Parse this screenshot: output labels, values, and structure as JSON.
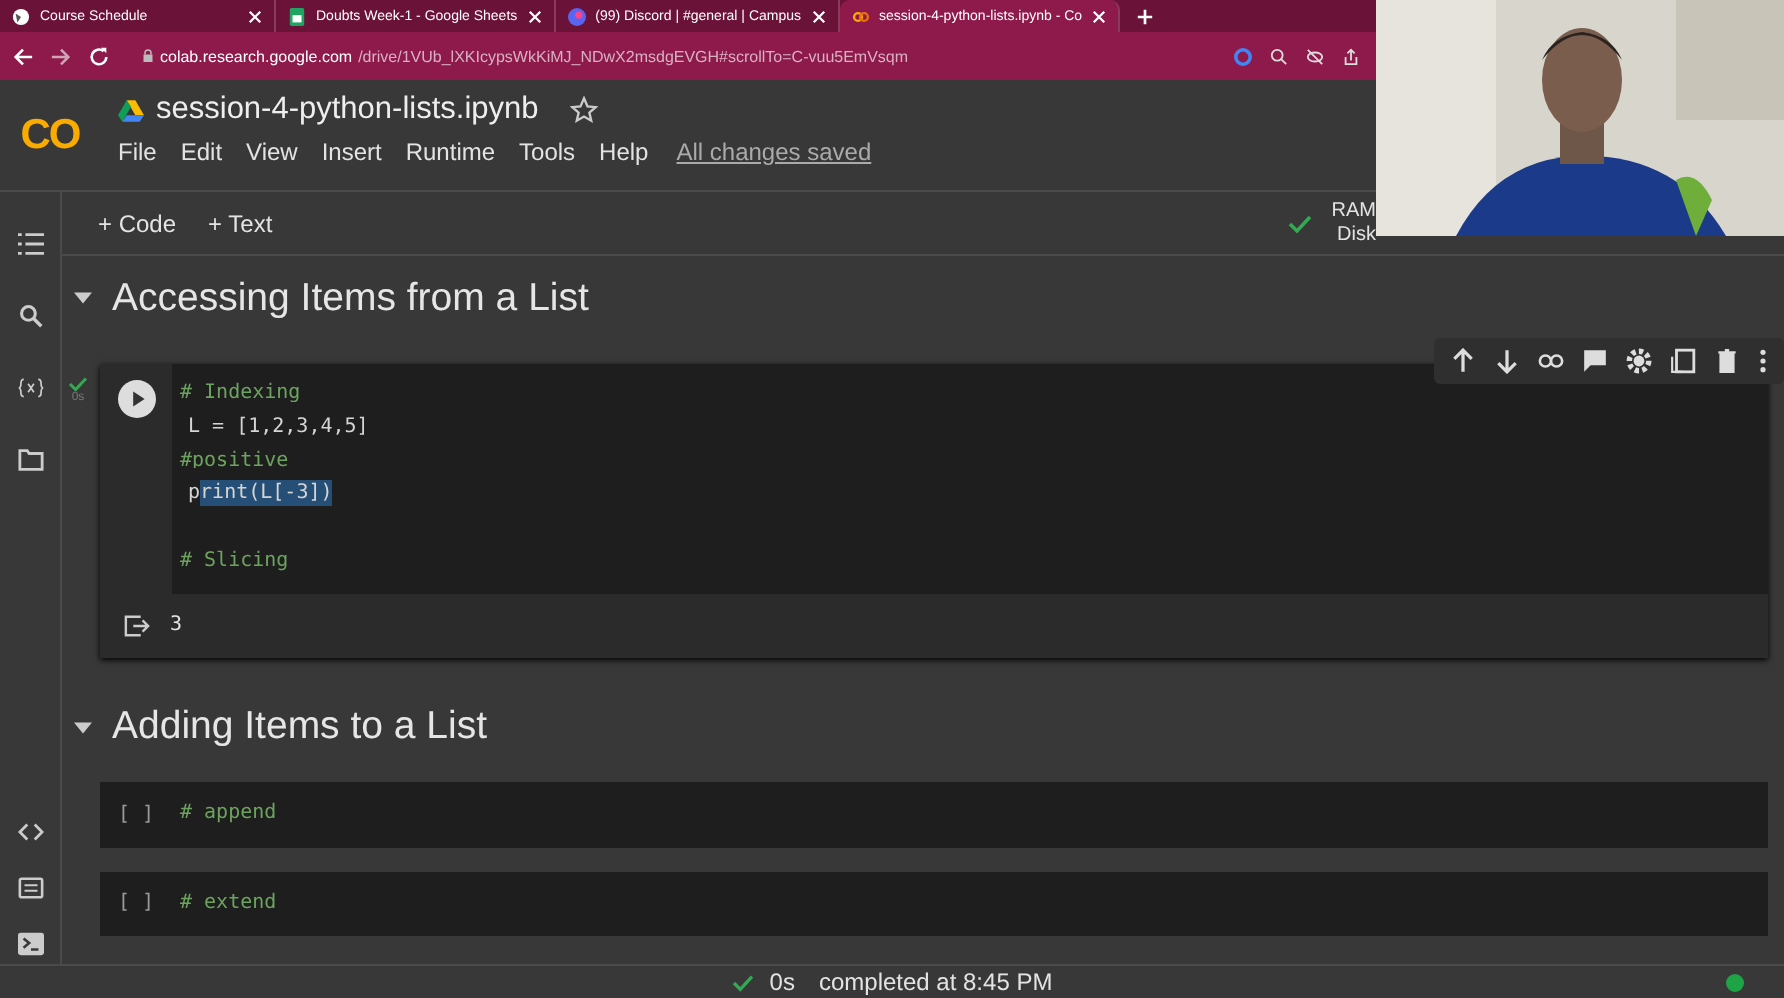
{
  "browser": {
    "tabs": [
      {
        "label": "Course Schedule",
        "selected": false
      },
      {
        "label": "Doubts Week-1 - Google Sheets",
        "selected": false
      },
      {
        "label": "(99) Discord | #general | Campus",
        "selected": false
      },
      {
        "label": "session-4-python-lists.ipynb - Co",
        "selected": true
      }
    ],
    "url_host": "colab.research.google.com",
    "url_path": "/drive/1VUb_lXKIcypsWkKiMJ_NDwX2msdgEVGH#scrollTo=C-vuu5EmVsqm"
  },
  "notebook": {
    "logo": "CO",
    "title": "session-4-python-lists.ipynb",
    "menu": [
      "File",
      "Edit",
      "View",
      "Insert",
      "Runtime",
      "Tools",
      "Help"
    ],
    "save_status": "All changes saved"
  },
  "toolbar": {
    "buttons": [
      "+ Code",
      "+ Text"
    ],
    "resources": [
      "RAM",
      "Disk"
    ]
  },
  "sections": [
    {
      "heading": "Accessing Items from a List",
      "cells": [
        {
          "run": true,
          "exec_time": "0s",
          "lines": [
            {
              "kind": "comment",
              "parts": [
                {
                  "text": "# Indexing",
                  "selected": false
                }
              ]
            },
            {
              "kind": "code",
              "parts": [
                {
                  "text": "L = [1,2,3,4,5]",
                  "selected": false
                }
              ]
            },
            {
              "kind": "comment",
              "parts": [
                {
                  "text": "#positive",
                  "selected": false
                }
              ]
            },
            {
              "kind": "code",
              "parts": [
                {
                  "text": "p",
                  "selected": false
                },
                {
                  "text": "rint(L[-3])",
                  "selected": true
                }
              ]
            },
            {
              "kind": "blank"
            },
            {
              "kind": "comment",
              "parts": [
                {
                  "text": "# Slicing",
                  "selected": false
                }
              ]
            }
          ],
          "output": "3"
        }
      ]
    },
    {
      "heading": "Adding Items to a List",
      "cells": [
        {
          "run": false,
          "prompt": "[ ]",
          "lines": [
            {
              "kind": "comment",
              "parts": [
                {
                  "text": "# append",
                  "selected": false
                }
              ]
            }
          ]
        },
        {
          "run": false,
          "prompt": "[ ]",
          "lines": [
            {
              "kind": "comment",
              "parts": [
                {
                  "text": "# extend",
                  "selected": false
                }
              ]
            }
          ]
        }
      ]
    }
  ],
  "status_bar": {
    "time": "0s",
    "message": "completed at 8:45 PM"
  }
}
